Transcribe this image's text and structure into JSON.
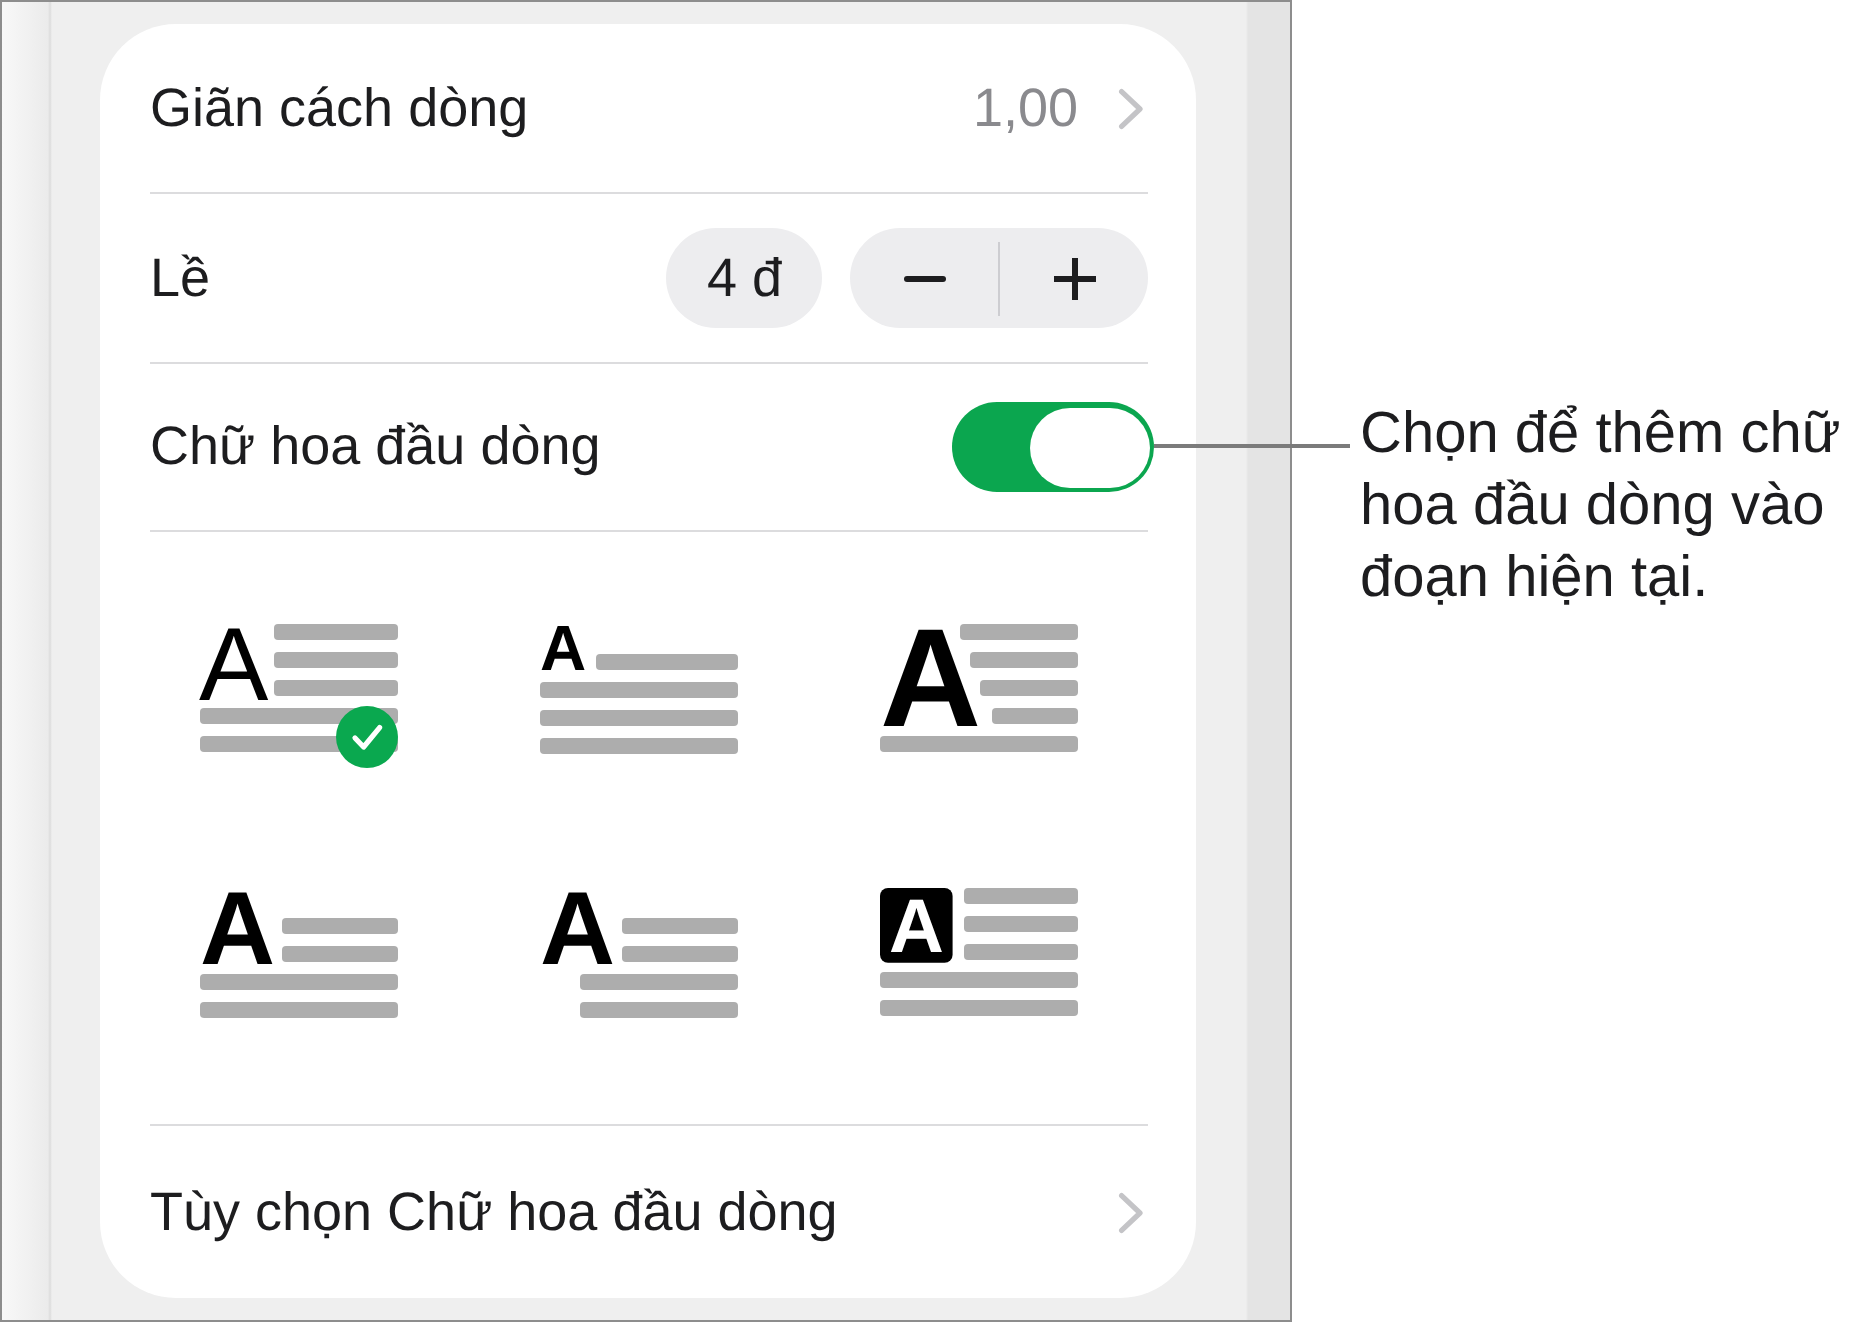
{
  "settings_rows": [
    {
      "kind": "disclosure",
      "label": "Giãn cách dòng",
      "value": "1,00"
    },
    {
      "kind": "stepper",
      "label": "Lề",
      "value": "4 đ"
    },
    {
      "kind": "toggle",
      "label": "Chữ hoa đầu dòng",
      "on": true
    }
  ],
  "drop_cap_styles": [
    {
      "kind": "raised-thin",
      "letter": "A",
      "selected": true
    },
    {
      "kind": "raised-small",
      "letter": "A",
      "selected": false
    },
    {
      "kind": "raised-large",
      "letter": "A",
      "selected": false
    },
    {
      "kind": "dropped",
      "letter": "A",
      "selected": false
    },
    {
      "kind": "hanging",
      "letter": "A",
      "selected": false
    },
    {
      "kind": "boxed",
      "letter": "A",
      "selected": false
    }
  ],
  "options_row": {
    "label": "Tùy chọn Chữ hoa đầu dòng"
  },
  "callout": {
    "text": "Chọn để thêm chữ hoa đầu dòng vào đoạn hiện tại."
  }
}
